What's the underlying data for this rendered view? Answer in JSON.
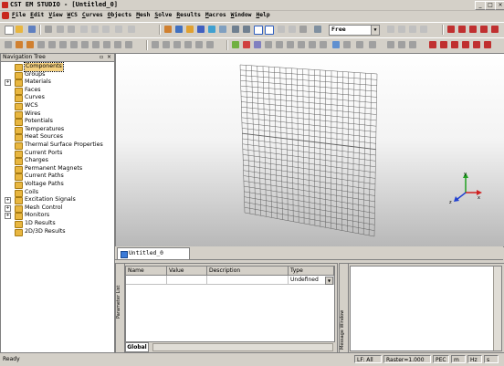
{
  "window": {
    "title": "CST EM STUDIO - [Untitled_0]",
    "controls": [
      "_",
      "□",
      "×"
    ]
  },
  "menubar": {
    "items": [
      "File",
      "Edit",
      "View",
      "WCS",
      "Curves",
      "Objects",
      "Mesh",
      "Solve",
      "Results",
      "Macros",
      "Window",
      "Help"
    ]
  },
  "toolbar": {
    "view_mode_value": "Free"
  },
  "nav_tree": {
    "title": "Navigation Tree",
    "items": [
      {
        "label": "Components",
        "expandable": false,
        "selected": true
      },
      {
        "label": "Groups",
        "expandable": false
      },
      {
        "label": "Materials",
        "expandable": true
      },
      {
        "label": "Faces",
        "expandable": false
      },
      {
        "label": "Curves",
        "expandable": false
      },
      {
        "label": "WCS",
        "expandable": false
      },
      {
        "label": "Wires",
        "expandable": false
      },
      {
        "label": "Potentials",
        "expandable": false
      },
      {
        "label": "Temperatures",
        "expandable": false
      },
      {
        "label": "Heat Sources",
        "expandable": false
      },
      {
        "label": "Thermal Surface Properties",
        "expandable": false
      },
      {
        "label": "Current Ports",
        "expandable": false
      },
      {
        "label": "Charges",
        "expandable": false
      },
      {
        "label": "Permanent Magnets",
        "expandable": false
      },
      {
        "label": "Current Paths",
        "expandable": false
      },
      {
        "label": "Voltage Paths",
        "expandable": false
      },
      {
        "label": "Coils",
        "expandable": false
      },
      {
        "label": "Excitation Signals",
        "expandable": true
      },
      {
        "label": "Mesh Control",
        "expandable": true
      },
      {
        "label": "Monitors",
        "expandable": true
      },
      {
        "label": "1D Results",
        "expandable": false
      },
      {
        "label": "2D/3D Results",
        "expandable": false
      }
    ]
  },
  "viewport": {
    "axes": {
      "x": "x",
      "y": "y",
      "z": "z"
    }
  },
  "document_tab": {
    "label": "Untitled_0"
  },
  "parameter_list": {
    "side_label": "Parameter List",
    "columns": [
      "Name",
      "Value",
      "Description",
      "Type"
    ],
    "rows": [
      {
        "name": "",
        "value": "",
        "description": "",
        "type": "Undefined"
      }
    ],
    "tab": "Global"
  },
  "message_window": {
    "side_label": "Message Window"
  },
  "statusbar": {
    "status": "Ready",
    "lf": "LF: All",
    "raster": "Raster=1.000",
    "mode": "PEC",
    "units": [
      "m",
      "Hz",
      "s"
    ]
  },
  "colors": {
    "window_bg": "#d4d0c8",
    "selection": "#f4d080",
    "grid_line": "#606060",
    "axis_x": "#d02020",
    "axis_y": "#20a020",
    "axis_z": "#2040d0"
  }
}
